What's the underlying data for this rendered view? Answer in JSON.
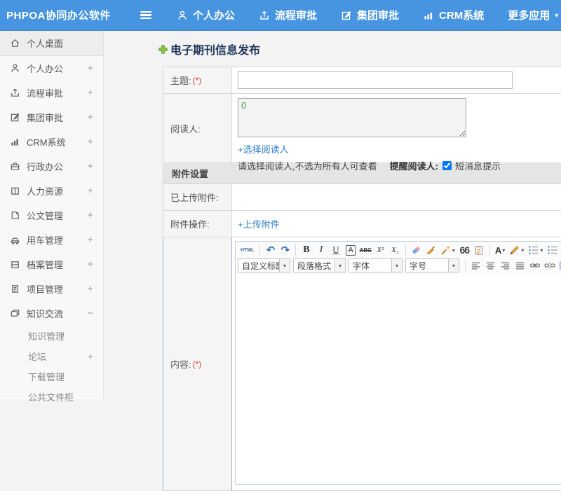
{
  "header": {
    "app_title": "PHPOA协同办公软件",
    "nav": [
      {
        "label": "个人办公"
      },
      {
        "label": "流程审批"
      },
      {
        "label": "集团审批"
      },
      {
        "label": "CRM系统"
      },
      {
        "label": "更多应用"
      }
    ],
    "more_caret": "▾"
  },
  "sidebar": {
    "items": [
      {
        "label": "个人桌面",
        "expand": ""
      },
      {
        "label": "个人办公",
        "expand": "+"
      },
      {
        "label": "流程审批",
        "expand": "+"
      },
      {
        "label": "集团审批",
        "expand": "+"
      },
      {
        "label": "CRM系统",
        "expand": "+"
      },
      {
        "label": "行政办公",
        "expand": "+"
      },
      {
        "label": "人力资源",
        "expand": "+"
      },
      {
        "label": "公文管理",
        "expand": "+"
      },
      {
        "label": "用车管理",
        "expand": "+"
      },
      {
        "label": "档案管理",
        "expand": "+"
      },
      {
        "label": "项目管理",
        "expand": "+"
      },
      {
        "label": "知识交流",
        "expand": "−"
      }
    ],
    "subitems": [
      {
        "label": "知识管理",
        "expand": ""
      },
      {
        "label": "论坛",
        "expand": "+"
      },
      {
        "label": "下载管理",
        "expand": ""
      },
      {
        "label": "公共文件柜",
        "expand": ""
      }
    ]
  },
  "main": {
    "page_title": "电子期刊信息发布",
    "form": {
      "subject_label": "主题:",
      "required_mark": "(*)",
      "readers_label": "阅读人:",
      "readers_value": "0",
      "select_readers_link": "+选择阅读人",
      "readers_hint": "请选择阅读人,不选为所有人可查看",
      "remind_label": "提醒阅读人:",
      "sms_checked": "true",
      "sms_label": "短消息提示",
      "attachment_section": "附件设置",
      "uploaded_label": "已上传附件:",
      "attachment_ops_label": "附件操作:",
      "upload_link": "+上传附件",
      "content_label": "内容:"
    },
    "editor": {
      "html_btn": "HTML",
      "undo_glyph": "↶",
      "redo_glyph": "↷",
      "bold": "B",
      "italic": "I",
      "underline": "U",
      "style_a": "A",
      "strike": "ABC",
      "sup": "X²",
      "sub": "X₂",
      "quote": "66",
      "font_color_a": "A",
      "caret": "▾",
      "heading_select": "自定义标题",
      "paragraph_select": "段落格式",
      "font_select": "字体",
      "size_select": "字号"
    },
    "colors": {
      "header_blue": "#4795e1",
      "link_blue": "#2a7dc9",
      "title_navy": "#21375c",
      "readers_green": "#3a9948"
    }
  }
}
